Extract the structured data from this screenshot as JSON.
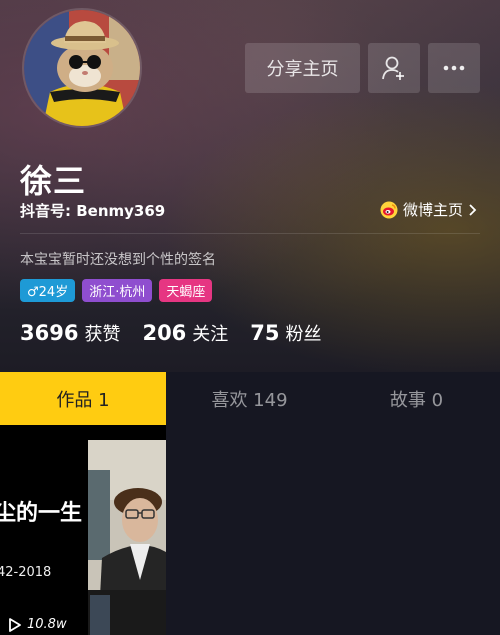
{
  "profile": {
    "name": "徐三",
    "douyin_id": "抖音号: Benmy369",
    "weibo_label": "微博主页",
    "bio": "本宝宝暂时还没想到个性的签名",
    "tags": {
      "age": "♂24岁",
      "location": "浙江·杭州",
      "zodiac": "天蝎座"
    }
  },
  "actions": {
    "share_label": "分享主页",
    "follow_icon": "add-friend-icon",
    "more_icon": "more-icon"
  },
  "stats": {
    "likes_count": "3696",
    "likes_label": "获赞",
    "following_count": "206",
    "following_label": "关注",
    "fans_count": "75",
    "fans_label": "粉丝"
  },
  "tabs": {
    "works": "作品 1",
    "likes": "喜欢 149",
    "story": "故事 0",
    "active": "works"
  },
  "videos": [
    {
      "title_fragment": "尘的一生",
      "subtitle_fragment": "42-2018",
      "plays": "10.8w"
    }
  ],
  "colors": {
    "accent_yellow": "#ffcc11",
    "tag_age": "#1e9ad6",
    "tag_location": "#8f4ecf",
    "tag_zodiac": "#e63682",
    "background": "#161722"
  }
}
